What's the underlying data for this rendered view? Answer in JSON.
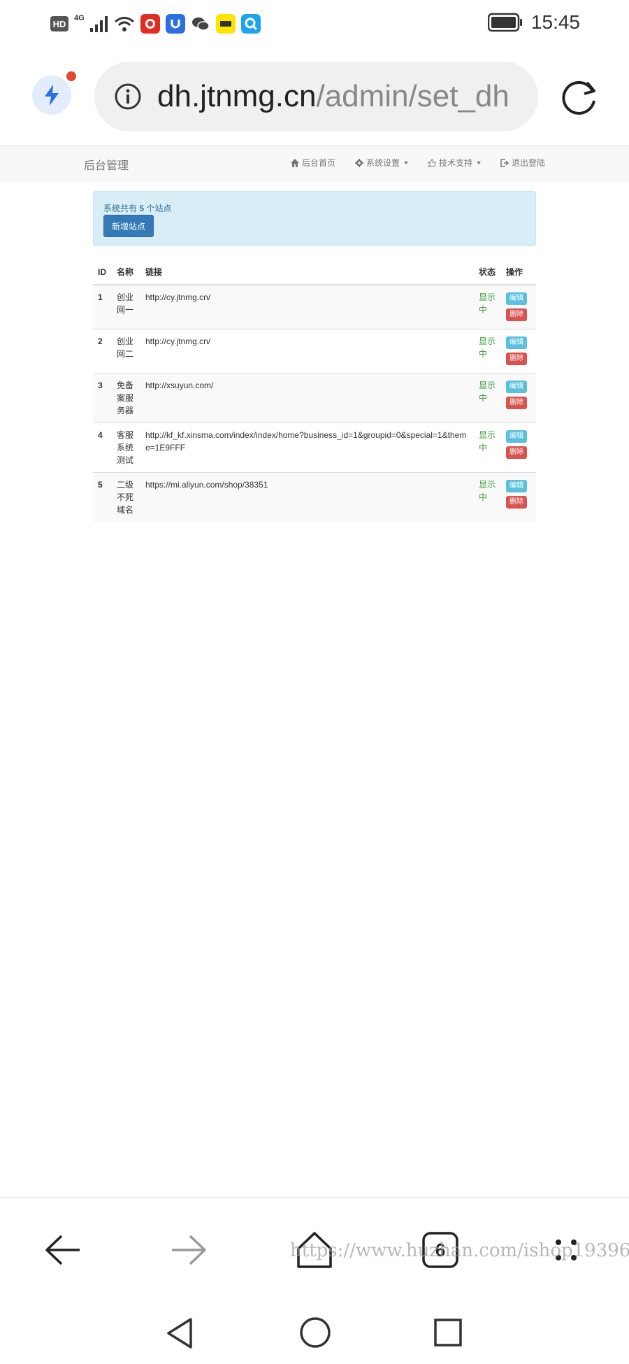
{
  "status_bar": {
    "hd": "HD",
    "network": "4G",
    "time": "15:45",
    "app_icons": [
      "pinduoduo-icon",
      "shield-app-icon",
      "wechat-icon",
      "xianyu-icon",
      "search-app-icon"
    ]
  },
  "browser": {
    "url_host": "dh.jtnmg.cn",
    "url_path": "/admin/set_dh",
    "notification_color": "#e0492f"
  },
  "navbar": {
    "brand": "后台管理",
    "items": [
      {
        "label": "后台首页",
        "icon": "home-icon"
      },
      {
        "label": "系统设置",
        "icon": "gear-icon"
      },
      {
        "label": "技术支持",
        "icon": "thumbs-up-icon"
      },
      {
        "label": "退出登陆",
        "icon": "logout-icon"
      }
    ]
  },
  "alert": {
    "prefix": "系统共有",
    "count": "5",
    "suffix": "个站点",
    "add_button": "新增站点"
  },
  "table": {
    "headers": {
      "id": "ID",
      "name": "名称",
      "link": "链接",
      "status": "状态",
      "ops": "操作"
    },
    "edit_label": "编辑",
    "delete_label": "删除",
    "rows": [
      {
        "id": "1",
        "name": "创业网一",
        "link": "http://cy.jtnmg.cn/",
        "status": "显示中"
      },
      {
        "id": "2",
        "name": "创业网二",
        "link": "http://cy.jtnmg.cn/",
        "status": "显示中"
      },
      {
        "id": "3",
        "name": "免备案服务器",
        "link": "http://xsuyun.com/",
        "status": "显示中"
      },
      {
        "id": "4",
        "name": "客服系统测试",
        "link": "http://kf_kf.xinsma.com/index/index/home?business_id=1&groupid=0&special=1&theme=1E9FFF",
        "status": "显示中"
      },
      {
        "id": "5",
        "name": "二级不死域名",
        "link": "https://mi.aliyun.com/shop/38351",
        "status": "显示中"
      }
    ]
  },
  "bottom_nav": {
    "tabs_count": "6"
  },
  "watermark": "https://www.huzhan.com/ishop19396",
  "colors": {
    "primary": "#337ab7",
    "info": "#5bc0de",
    "danger": "#d9534f",
    "success_text": "#3c9a3c",
    "alert_bg": "#d9edf7"
  }
}
